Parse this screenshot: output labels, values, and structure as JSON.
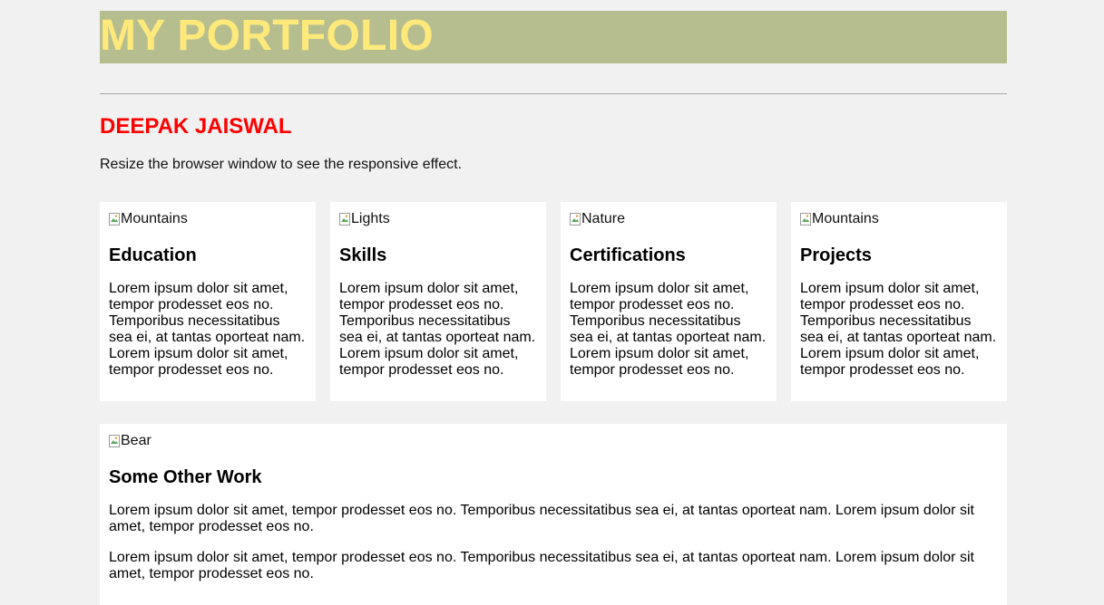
{
  "header": {
    "title": "MY PORTFOLIO",
    "title_bg": "#b6be8f",
    "title_color": "#ffe97b"
  },
  "profile": {
    "name": "DEEPAK JAISWAL",
    "name_color": "#ff0000",
    "subtitle": "Resize the browser window to see the responsive effect."
  },
  "cards": [
    {
      "img_alt": "Mountains",
      "heading": "Education",
      "text": "Lorem ipsum dolor sit amet, tempor prodesset eos no. Temporibus necessitatibus sea ei, at tantas oporteat nam. Lorem ipsum dolor sit amet, tempor prodesset eos no."
    },
    {
      "img_alt": "Lights",
      "heading": "Skills",
      "text": "Lorem ipsum dolor sit amet, tempor prodesset eos no. Temporibus necessitatibus sea ei, at tantas oporteat nam. Lorem ipsum dolor sit amet, tempor prodesset eos no."
    },
    {
      "img_alt": "Nature",
      "heading": "Certifications",
      "text": "Lorem ipsum dolor sit amet, tempor prodesset eos no. Temporibus necessitatibus sea ei, at tantas oporteat nam. Lorem ipsum dolor sit amet, tempor prodesset eos no."
    },
    {
      "img_alt": "Mountains",
      "heading": "Projects",
      "text": "Lorem ipsum dolor sit amet, tempor prodesset eos no. Temporibus necessitatibus sea ei, at tantas oporteat nam. Lorem ipsum dolor sit amet, tempor prodesset eos no."
    }
  ],
  "other_work": {
    "img_alt": "Bear",
    "heading": "Some Other Work",
    "paragraphs": [
      "Lorem ipsum dolor sit amet, tempor prodesset eos no. Temporibus necessitatibus sea ei, at tantas oporteat nam. Lorem ipsum dolor sit amet, tempor prodesset eos no.",
      "Lorem ipsum dolor sit amet, tempor prodesset eos no. Temporibus necessitatibus sea ei, at tantas oporteat nam. Lorem ipsum dolor sit amet, tempor prodesset eos no."
    ]
  },
  "icons": {
    "broken_image": "broken-image-icon"
  }
}
